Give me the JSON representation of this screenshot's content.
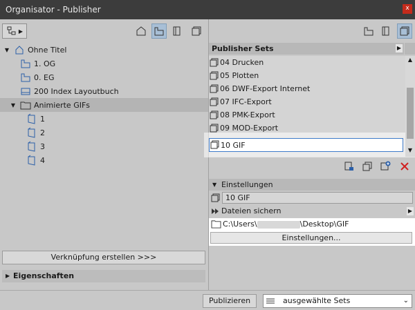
{
  "window": {
    "title": "Organisator - Publisher",
    "close_glyph": "x"
  },
  "left_tree": {
    "items": [
      {
        "label": "Ohne Titel",
        "icon": "project-tree-icon",
        "arrow": "▼"
      },
      {
        "label": "1. OG",
        "icon": "story-icon"
      },
      {
        "label": "0. EG",
        "icon": "story-icon"
      },
      {
        "label": "200 Index Layoutbuch",
        "icon": "layout-book-icon"
      },
      {
        "label": "Animierte GIFs",
        "icon": "folder-icon",
        "arrow": "▼"
      },
      {
        "label": "1",
        "icon": "camera-icon"
      },
      {
        "label": "2",
        "icon": "camera-icon"
      },
      {
        "label": "3",
        "icon": "camera-icon"
      },
      {
        "label": "4",
        "icon": "camera-icon"
      }
    ]
  },
  "left_bottom": {
    "link_button": "Verknüpfung erstellen >>>",
    "properties_label": "Eigenschaften",
    "properties_arrow": "▶"
  },
  "right": {
    "header_label": "Publisher Sets",
    "header_arrow": "▶",
    "sets": [
      "04 Drucken",
      "05 Plotten",
      "06 DWF-Export Internet",
      "07 IFC-Export",
      "08 PMK-Export",
      "09 MOD-Export"
    ],
    "editing_set": "10 GIF",
    "scroll_up": "▲",
    "scroll_down": "▼",
    "settings_header": "Einstellungen",
    "settings_arrow": "▼",
    "set_name": "10 GIF",
    "save_files_label": "Dateien sichern",
    "save_files_arrow": "▶",
    "path_prefix": "C:\\Users\\",
    "path_suffix": "\\Desktop\\GIF",
    "settings_button": "Einstellungen..."
  },
  "bottom": {
    "publish_button": "Publizieren",
    "mode_select": "ausgewählte Sets",
    "mode_chevron": "⌄"
  },
  "colors": {
    "titlebar": "#3c3c3c",
    "accent": "#3d7ac9",
    "close": "#c42b1c",
    "delete": "#d02020"
  }
}
